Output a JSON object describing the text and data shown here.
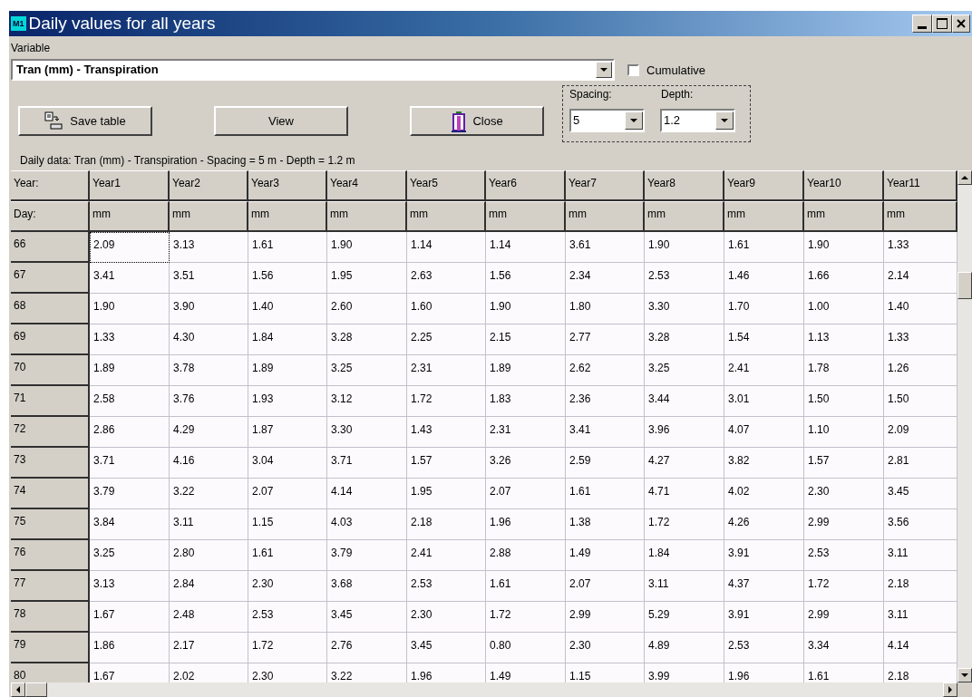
{
  "window": {
    "title": "Daily values for all years",
    "app_badge": "M1"
  },
  "variable": {
    "label": "Variable",
    "value": "Tran (mm) - Transpiration"
  },
  "cumulative": {
    "label": "Cumulative",
    "checked": false
  },
  "buttons": [
    {
      "kind": "save",
      "label": "Save table"
    },
    {
      "kind": "plain",
      "label": "View"
    },
    {
      "kind": "close",
      "label": "Close"
    }
  ],
  "spacing": {
    "label": "Spacing:",
    "value": "5"
  },
  "depth": {
    "label": "Depth:",
    "value": "1.2"
  },
  "caption": "Daily data: Tran (mm) - Transpiration - Spacing = 5 m - Depth = 1.2 m",
  "table": {
    "header_row": [
      "Year:",
      "Year1",
      "Year2",
      "Year3",
      "Year4",
      "Year5",
      "Year6",
      "Year7",
      "Year8",
      "Year9",
      "Year10",
      "Year11"
    ],
    "unit_row": [
      "Day:",
      "mm",
      "mm",
      "mm",
      "mm",
      "mm",
      "mm",
      "mm",
      "mm",
      "mm",
      "mm",
      "mm"
    ],
    "rows": [
      {
        "day": "66",
        "cells": [
          {
            "text": "2.09",
            "focused": true
          },
          {
            "text": "3.13",
            "focused": false
          },
          {
            "text": "1.61",
            "focused": false
          },
          {
            "text": "1.90",
            "focused": false
          },
          {
            "text": "1.14",
            "focused": false
          },
          {
            "text": "1.14",
            "focused": false
          },
          {
            "text": "3.61",
            "focused": false
          },
          {
            "text": "1.90",
            "focused": false
          },
          {
            "text": "1.61",
            "focused": false
          },
          {
            "text": "1.90",
            "focused": false
          },
          {
            "text": "1.33",
            "focused": false
          }
        ]
      },
      {
        "day": "67",
        "cells": [
          {
            "text": "3.41",
            "focused": false
          },
          {
            "text": "3.51",
            "focused": false
          },
          {
            "text": "1.56",
            "focused": false
          },
          {
            "text": "1.95",
            "focused": false
          },
          {
            "text": "2.63",
            "focused": false
          },
          {
            "text": "1.56",
            "focused": false
          },
          {
            "text": "2.34",
            "focused": false
          },
          {
            "text": "2.53",
            "focused": false
          },
          {
            "text": "1.46",
            "focused": false
          },
          {
            "text": "1.66",
            "focused": false
          },
          {
            "text": "2.14",
            "focused": false
          }
        ]
      },
      {
        "day": "68",
        "cells": [
          {
            "text": "1.90",
            "focused": false
          },
          {
            "text": "3.90",
            "focused": false
          },
          {
            "text": "1.40",
            "focused": false
          },
          {
            "text": "2.60",
            "focused": false
          },
          {
            "text": "1.60",
            "focused": false
          },
          {
            "text": "1.90",
            "focused": false
          },
          {
            "text": "1.80",
            "focused": false
          },
          {
            "text": "3.30",
            "focused": false
          },
          {
            "text": "1.70",
            "focused": false
          },
          {
            "text": "1.00",
            "focused": false
          },
          {
            "text": "1.40",
            "focused": false
          }
        ]
      },
      {
        "day": "69",
        "cells": [
          {
            "text": "1.33",
            "focused": false
          },
          {
            "text": "4.30",
            "focused": false
          },
          {
            "text": "1.84",
            "focused": false
          },
          {
            "text": "3.28",
            "focused": false
          },
          {
            "text": "2.25",
            "focused": false
          },
          {
            "text": "2.15",
            "focused": false
          },
          {
            "text": "2.77",
            "focused": false
          },
          {
            "text": "3.28",
            "focused": false
          },
          {
            "text": "1.54",
            "focused": false
          },
          {
            "text": "1.13",
            "focused": false
          },
          {
            "text": "1.33",
            "focused": false
          }
        ]
      },
      {
        "day": "70",
        "cells": [
          {
            "text": "1.89",
            "focused": false
          },
          {
            "text": "3.78",
            "focused": false
          },
          {
            "text": "1.89",
            "focused": false
          },
          {
            "text": "3.25",
            "focused": false
          },
          {
            "text": "2.31",
            "focused": false
          },
          {
            "text": "1.89",
            "focused": false
          },
          {
            "text": "2.62",
            "focused": false
          },
          {
            "text": "3.25",
            "focused": false
          },
          {
            "text": "2.41",
            "focused": false
          },
          {
            "text": "1.78",
            "focused": false
          },
          {
            "text": "1.26",
            "focused": false
          }
        ]
      },
      {
        "day": "71",
        "cells": [
          {
            "text": "2.58",
            "focused": false
          },
          {
            "text": "3.76",
            "focused": false
          },
          {
            "text": "1.93",
            "focused": false
          },
          {
            "text": "3.12",
            "focused": false
          },
          {
            "text": "1.72",
            "focused": false
          },
          {
            "text": "1.83",
            "focused": false
          },
          {
            "text": "2.36",
            "focused": false
          },
          {
            "text": "3.44",
            "focused": false
          },
          {
            "text": "3.01",
            "focused": false
          },
          {
            "text": "1.50",
            "focused": false
          },
          {
            "text": "1.50",
            "focused": false
          }
        ]
      },
      {
        "day": "72",
        "cells": [
          {
            "text": "2.86",
            "focused": false
          },
          {
            "text": "4.29",
            "focused": false
          },
          {
            "text": "1.87",
            "focused": false
          },
          {
            "text": "3.30",
            "focused": false
          },
          {
            "text": "1.43",
            "focused": false
          },
          {
            "text": "2.31",
            "focused": false
          },
          {
            "text": "3.41",
            "focused": false
          },
          {
            "text": "3.96",
            "focused": false
          },
          {
            "text": "4.07",
            "focused": false
          },
          {
            "text": "1.10",
            "focused": false
          },
          {
            "text": "2.09",
            "focused": false
          }
        ]
      },
      {
        "day": "73",
        "cells": [
          {
            "text": "3.71",
            "focused": false
          },
          {
            "text": "4.16",
            "focused": false
          },
          {
            "text": "3.04",
            "focused": false
          },
          {
            "text": "3.71",
            "focused": false
          },
          {
            "text": "1.57",
            "focused": false
          },
          {
            "text": "3.26",
            "focused": false
          },
          {
            "text": "2.59",
            "focused": false
          },
          {
            "text": "4.27",
            "focused": false
          },
          {
            "text": "3.82",
            "focused": false
          },
          {
            "text": "1.57",
            "focused": false
          },
          {
            "text": "2.81",
            "focused": false
          }
        ]
      },
      {
        "day": "74",
        "cells": [
          {
            "text": "3.79",
            "focused": false
          },
          {
            "text": "3.22",
            "focused": false
          },
          {
            "text": "2.07",
            "focused": false
          },
          {
            "text": "4.14",
            "focused": false
          },
          {
            "text": "1.95",
            "focused": false
          },
          {
            "text": "2.07",
            "focused": false
          },
          {
            "text": "1.61",
            "focused": false
          },
          {
            "text": "4.71",
            "focused": false
          },
          {
            "text": "4.02",
            "focused": false
          },
          {
            "text": "2.30",
            "focused": false
          },
          {
            "text": "3.45",
            "focused": false
          }
        ]
      },
      {
        "day": "75",
        "cells": [
          {
            "text": "3.84",
            "focused": false
          },
          {
            "text": "3.11",
            "focused": false
          },
          {
            "text": "1.15",
            "focused": false
          },
          {
            "text": "4.03",
            "focused": false
          },
          {
            "text": "2.18",
            "focused": false
          },
          {
            "text": "1.96",
            "focused": false
          },
          {
            "text": "1.38",
            "focused": false
          },
          {
            "text": "1.72",
            "focused": false
          },
          {
            "text": "4.26",
            "focused": false
          },
          {
            "text": "2.99",
            "focused": false
          },
          {
            "text": "3.56",
            "focused": false
          }
        ]
      },
      {
        "day": "76",
        "cells": [
          {
            "text": "3.25",
            "focused": false
          },
          {
            "text": "2.80",
            "focused": false
          },
          {
            "text": "1.61",
            "focused": false
          },
          {
            "text": "3.79",
            "focused": false
          },
          {
            "text": "2.41",
            "focused": false
          },
          {
            "text": "2.88",
            "focused": false
          },
          {
            "text": "1.49",
            "focused": false
          },
          {
            "text": "1.84",
            "focused": false
          },
          {
            "text": "3.91",
            "focused": false
          },
          {
            "text": "2.53",
            "focused": false
          },
          {
            "text": "3.11",
            "focused": false
          }
        ]
      },
      {
        "day": "77",
        "cells": [
          {
            "text": "3.13",
            "focused": false
          },
          {
            "text": "2.84",
            "focused": false
          },
          {
            "text": "2.30",
            "focused": false
          },
          {
            "text": "3.68",
            "focused": false
          },
          {
            "text": "2.53",
            "focused": false
          },
          {
            "text": "1.61",
            "focused": false
          },
          {
            "text": "2.07",
            "focused": false
          },
          {
            "text": "3.11",
            "focused": false
          },
          {
            "text": "4.37",
            "focused": false
          },
          {
            "text": "1.72",
            "focused": false
          },
          {
            "text": "2.18",
            "focused": false
          }
        ]
      },
      {
        "day": "78",
        "cells": [
          {
            "text": "1.67",
            "focused": false
          },
          {
            "text": "2.48",
            "focused": false
          },
          {
            "text": "2.53",
            "focused": false
          },
          {
            "text": "3.45",
            "focused": false
          },
          {
            "text": "2.30",
            "focused": false
          },
          {
            "text": "1.72",
            "focused": false
          },
          {
            "text": "2.99",
            "focused": false
          },
          {
            "text": "5.29",
            "focused": false
          },
          {
            "text": "3.91",
            "focused": false
          },
          {
            "text": "2.99",
            "focused": false
          },
          {
            "text": "3.11",
            "focused": false
          }
        ]
      },
      {
        "day": "79",
        "cells": [
          {
            "text": "1.86",
            "focused": false
          },
          {
            "text": "2.17",
            "focused": false
          },
          {
            "text": "1.72",
            "focused": false
          },
          {
            "text": "2.76",
            "focused": false
          },
          {
            "text": "3.45",
            "focused": false
          },
          {
            "text": "0.80",
            "focused": false
          },
          {
            "text": "2.30",
            "focused": false
          },
          {
            "text": "4.89",
            "focused": false
          },
          {
            "text": "2.53",
            "focused": false
          },
          {
            "text": "3.34",
            "focused": false
          },
          {
            "text": "4.14",
            "focused": false
          }
        ]
      },
      {
        "day": "80",
        "cells": [
          {
            "text": "1.67",
            "focused": false
          },
          {
            "text": "2.02",
            "focused": false
          },
          {
            "text": "2.30",
            "focused": false
          },
          {
            "text": "3.22",
            "focused": false
          },
          {
            "text": "1.96",
            "focused": false
          },
          {
            "text": "1.49",
            "focused": false
          },
          {
            "text": "1.15",
            "focused": false
          },
          {
            "text": "3.99",
            "focused": false
          },
          {
            "text": "1.96",
            "focused": false
          },
          {
            "text": "1.61",
            "focused": false
          },
          {
            "text": "2.18",
            "focused": false
          }
        ]
      }
    ]
  }
}
